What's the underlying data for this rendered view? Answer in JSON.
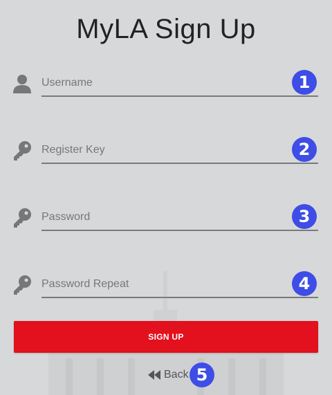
{
  "page": {
    "title": "MyLA Sign Up"
  },
  "form": {
    "fields": [
      {
        "placeholder": "Username",
        "value": "",
        "icon": "user-icon"
      },
      {
        "placeholder": "Register Key",
        "value": "",
        "icon": "key-icon"
      },
      {
        "placeholder": "Password",
        "value": "",
        "icon": "key-icon"
      },
      {
        "placeholder": "Password Repeat",
        "value": "",
        "icon": "key-icon"
      }
    ],
    "signup_label": "SIGN UP",
    "back_label": "Back",
    "back_icon": "double-chevron-left-icon"
  },
  "badges": [
    "1",
    "2",
    "3",
    "4",
    "5"
  ],
  "colors": {
    "background": "#d7d8da",
    "accent": "#e3101d",
    "badge": "#3e4de6",
    "icon": "#777777"
  }
}
